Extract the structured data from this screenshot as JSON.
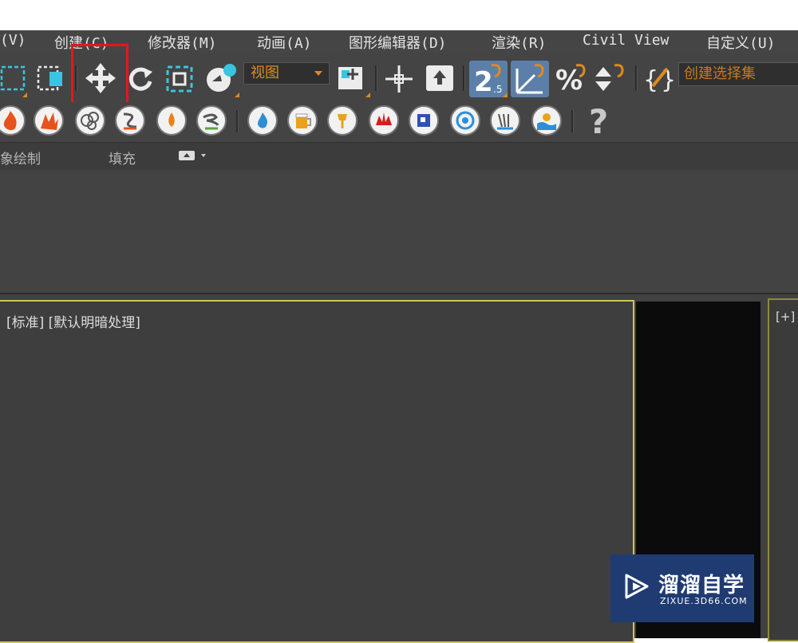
{
  "menu": {
    "items": [
      {
        "label": "(V)"
      },
      {
        "label": "创建(C)"
      },
      {
        "label": "修改器(M)"
      },
      {
        "label": "动画(A)"
      },
      {
        "label": "图形编辑器(D)"
      },
      {
        "label": "渲染(R)"
      },
      {
        "label": "Civil View"
      },
      {
        "label": "自定义(U)"
      }
    ]
  },
  "toolbar": {
    "view_combo_value": "视图",
    "selection_set_placeholder": "创建选择集",
    "snap_25_label": "2.5",
    "help_label": "?"
  },
  "ribbon": {
    "tabs": [
      {
        "label": "象绘制"
      },
      {
        "label": "填充"
      }
    ]
  },
  "viewports": {
    "main_label": "[标准] [默认明暗处理]",
    "right_label": "[+]"
  },
  "watermark": {
    "title": "溜溜自学",
    "subtitle": "ZIXUE.3D66.COM"
  },
  "colors": {
    "accent": "#e08a1c",
    "highlight": "#e0191b",
    "viewport_border": "#cfc35a",
    "active_tool": "#5b7fa8"
  }
}
